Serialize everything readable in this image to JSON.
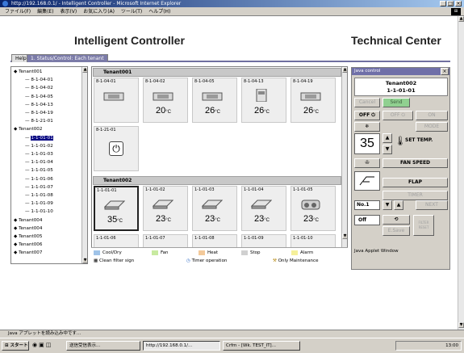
{
  "window": {
    "title": "http://192.168.0.1/ - Intelligent Controller - Microsoft Internet Explorer",
    "min": "_",
    "max": "□",
    "close": "×"
  },
  "menu": [
    "ファイル(F)",
    "編集(E)",
    "表示(V)",
    "お気に入り(A)",
    "ツール(T)",
    "ヘルプ(H)"
  ],
  "header": {
    "app_title": "Intelligent Controller",
    "site_title": "Technical Center"
  },
  "tabs": [
    "Help",
    "1. Status/Control: Each tenant"
  ],
  "tree": {
    "items": [
      {
        "label": "Tenant001",
        "level": 0,
        "selected": false
      },
      {
        "label": "8-1-04-01",
        "level": 1,
        "selected": false
      },
      {
        "label": "8-1-04-02",
        "level": 1,
        "selected": false
      },
      {
        "label": "8-1-04-05",
        "level": 1,
        "selected": false
      },
      {
        "label": "8-1-04-13",
        "level": 1,
        "selected": false
      },
      {
        "label": "8-1-04-19",
        "level": 1,
        "selected": false
      },
      {
        "label": "8-1-21-01",
        "level": 1,
        "selected": false
      },
      {
        "label": "Tenant002",
        "level": 0,
        "selected": false
      },
      {
        "label": "1-1-01-01",
        "level": 1,
        "selected": true
      },
      {
        "label": "1-1-01-02",
        "level": 1,
        "selected": false
      },
      {
        "label": "1-1-01-03",
        "level": 1,
        "selected": false
      },
      {
        "label": "1-1-01-04",
        "level": 1,
        "selected": false
      },
      {
        "label": "1-1-01-05",
        "level": 1,
        "selected": false
      },
      {
        "label": "1-1-01-06",
        "level": 1,
        "selected": false
      },
      {
        "label": "1-1-01-07",
        "level": 1,
        "selected": false
      },
      {
        "label": "1-1-01-08",
        "level": 1,
        "selected": false
      },
      {
        "label": "1-1-01-09",
        "level": 1,
        "selected": false
      },
      {
        "label": "1-1-01-10",
        "level": 1,
        "selected": false
      },
      {
        "label": "Tenant004",
        "level": 0,
        "selected": false
      },
      {
        "label": "Tenant004",
        "level": 0,
        "selected": false
      },
      {
        "label": "Tenant005",
        "level": 0,
        "selected": false
      },
      {
        "label": "Tenant006",
        "level": 0,
        "selected": false
      },
      {
        "label": "Tenant007",
        "level": 0,
        "selected": false
      }
    ]
  },
  "groups": [
    {
      "name": "Tenant001",
      "units": [
        {
          "name": "8-1-04-01",
          "temp": "",
          "unit": "",
          "type": "cassette"
        },
        {
          "name": "8-1-04-02",
          "temp": "20",
          "unit": "°C",
          "type": "cassette"
        },
        {
          "name": "8-1-04-05",
          "temp": "26",
          "unit": "°C",
          "type": "cassette"
        },
        {
          "name": "8-1-04-13",
          "temp": "26",
          "unit": "°C",
          "type": "floor"
        },
        {
          "name": "8-1-04-19",
          "temp": "26",
          "unit": "°C",
          "type": "cassette"
        },
        {
          "name": "8-1-21-01",
          "temp": "",
          "unit": "",
          "type": "power"
        }
      ]
    },
    {
      "name": "Tenant002",
      "units": [
        {
          "name": "1-1-01-01",
          "temp": "35",
          "unit": "°C",
          "type": "ceiling",
          "selected": true
        },
        {
          "name": "1-1-01-02",
          "temp": "23",
          "unit": "°C",
          "type": "ceiling"
        },
        {
          "name": "1-1-01-03",
          "temp": "23",
          "unit": "°C",
          "type": "ceiling"
        },
        {
          "name": "1-1-01-04",
          "temp": "23",
          "unit": "°C",
          "type": "ceiling"
        },
        {
          "name": "1-1-01-05",
          "temp": "23",
          "unit": "°C",
          "type": "outdoor"
        },
        {
          "name": "1-1-01-06",
          "temp": "",
          "unit": "",
          "type": "outdoor"
        },
        {
          "name": "1-1-01-07",
          "temp": "",
          "unit": "",
          "type": "box"
        },
        {
          "name": "1-1-01-08",
          "temp": "",
          "unit": "",
          "type": "wall"
        },
        {
          "name": "1-1-01-09",
          "temp": "",
          "unit": "",
          "type": "wall"
        },
        {
          "name": "1-1-01-10",
          "temp": "",
          "unit": "",
          "type": "outdoor"
        }
      ]
    }
  ],
  "legend": {
    "cool_dry": "Cool/Dry",
    "fan": "Fan",
    "heat": "Heat",
    "stop": "Stop",
    "alarm": "Alarm",
    "clean_filter": "Clean filter sign",
    "timer": "Timer operation",
    "mainte": "Only Maintenance",
    "colors": {
      "cool_dry": "#9fc3e8",
      "fan": "#c8eaa0",
      "heat": "#f3c99a",
      "stop": "#d0d0d0",
      "alarm": "#f5f09a"
    }
  },
  "remote": {
    "title": "Java control",
    "close": "×",
    "tenant": "Tenant002",
    "unit": "1-1-01-01",
    "cancel": "Cancel",
    "send": "Send",
    "off": "OFF ⏻",
    "off_alt": "OFF ⏻",
    "on": "ON",
    "mode": "MODE",
    "temp": "35",
    "set_temp": "SET TEMP.",
    "fan_speed": "FAN SPEED",
    "flap": "FLAP",
    "timer": "TIMER",
    "no": "No.1",
    "next": "NEXT",
    "off2": "Off",
    "esave": "E.Save",
    "filter_reset": "FILTER RESET",
    "status": "Java Applet Window"
  },
  "status_bar": "Java アプレットを読み込み中です...",
  "taskbar": {
    "start": "スタート",
    "items": [
      "送信受信表示...",
      "http://192.168.0.1/...",
      "Crfm - [Wk. TEST_IT]..."
    ],
    "clock": "13:00"
  }
}
